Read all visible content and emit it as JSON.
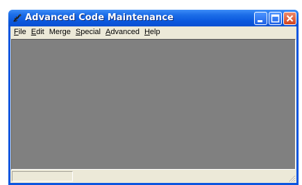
{
  "window": {
    "title": "Advanced Code Maintenance",
    "app_icon": "scorpion-icon",
    "controls": [
      "minimize-icon",
      "maximize-icon",
      "close-icon"
    ]
  },
  "menubar": {
    "items": [
      {
        "mnemonic": "F",
        "rest": "ile"
      },
      {
        "mnemonic": "E",
        "rest": "dit"
      },
      {
        "pre": "Merge"
      },
      {
        "mnemonic": "S",
        "rest": "pecial"
      },
      {
        "mnemonic": "A",
        "rest": "dvanced"
      },
      {
        "mnemonic": "H",
        "rest": "elp"
      }
    ]
  },
  "statusbar": {
    "pane1": "",
    "pane2": ""
  },
  "colors": {
    "titlebar": "#0a55df",
    "workspace": "#808080",
    "chrome": "#ece9d8",
    "close_button": "#d2431d"
  }
}
